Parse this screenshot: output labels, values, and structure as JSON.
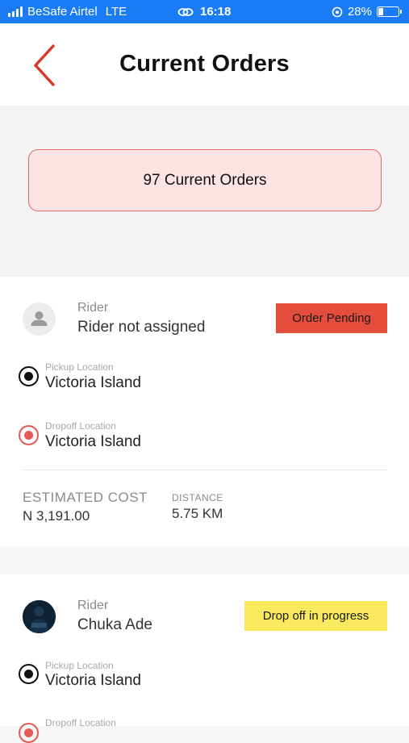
{
  "status_bar": {
    "carrier": "BeSafe Airtel",
    "network": "LTE",
    "time": "16:18",
    "battery": "28%",
    "battery_level": 0.28
  },
  "header": {
    "title": "Current Orders",
    "back_icon": "chevron-left-icon"
  },
  "summary": {
    "label": "97 Current Orders"
  },
  "orders": [
    {
      "rider_label": "Rider",
      "rider_name": "Rider not assigned",
      "status": "Order Pending",
      "status_color": "#e44d3c",
      "pickup_label": "Pickup Location",
      "pickup_value": "Victoria Island",
      "dropoff_label": "Dropoff Location",
      "dropoff_value": "Victoria Island",
      "cost_label": "ESTIMATED COST",
      "cost_value": "N 3,191.00",
      "distance_label": "DISTANCE",
      "distance_value": "5.75 KM"
    },
    {
      "rider_label": "Rider",
      "rider_name": "Chuka Ade",
      "status": "Drop off in progress",
      "status_color": "#f8ea5c",
      "pickup_label": "Pickup Location",
      "pickup_value": "Victoria Island",
      "dropoff_label": "Dropoff Location"
    }
  ],
  "colors": {
    "status_bar": "#1a7cf5",
    "accent_red": "#d9382c",
    "summary_bg": "#fbe4e3",
    "summary_border": "#e06a62"
  }
}
